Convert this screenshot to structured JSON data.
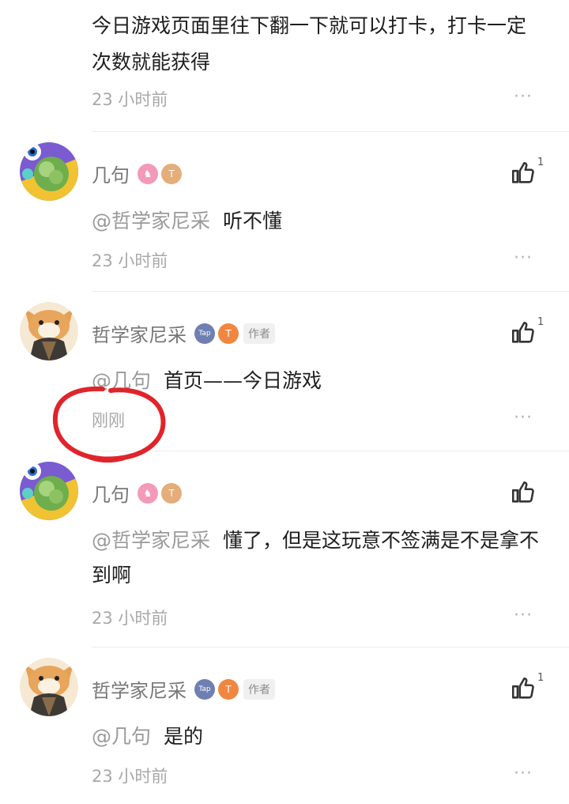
{
  "top_comment": {
    "text": "今日游戏页面里往下翻一下就可以打卡，打卡一定次数就能获得",
    "time": "23 小时前",
    "more": "···"
  },
  "replies": [
    {
      "username": "几句",
      "badges": [
        "pink-medal-icon",
        "tan-level-icon"
      ],
      "mention": "@哲学家尼采",
      "text": "听不懂",
      "time": "23 小时前",
      "like_count": "1",
      "more": "···",
      "author_tag": ""
    },
    {
      "username": "哲学家尼采",
      "badges": [
        "tap-badge-icon",
        "orange-level-icon"
      ],
      "author_tag": "作者",
      "mention": "@几句",
      "text": "首页——今日游戏",
      "time": "刚刚",
      "like_count": "1",
      "more": "···"
    },
    {
      "username": "几句",
      "badges": [
        "pink-medal-icon",
        "tan-level-icon"
      ],
      "mention": "@哲学家尼采",
      "text": "懂了，但是这玩意不签满是不是拿不到啊",
      "time": "23 小时前",
      "like_count": "",
      "more": "···",
      "author_tag": ""
    },
    {
      "username": "哲学家尼采",
      "badges": [
        "tap-badge-icon",
        "orange-level-icon"
      ],
      "author_tag": "作者",
      "mention": "@几句",
      "text": "是的",
      "time": "23 小时前",
      "like_count": "1",
      "more": "···"
    }
  ],
  "colors": {
    "annotation_circle": "#e0242b",
    "muted_text": "#a8a8a8",
    "mention": "#9a9a9a"
  }
}
